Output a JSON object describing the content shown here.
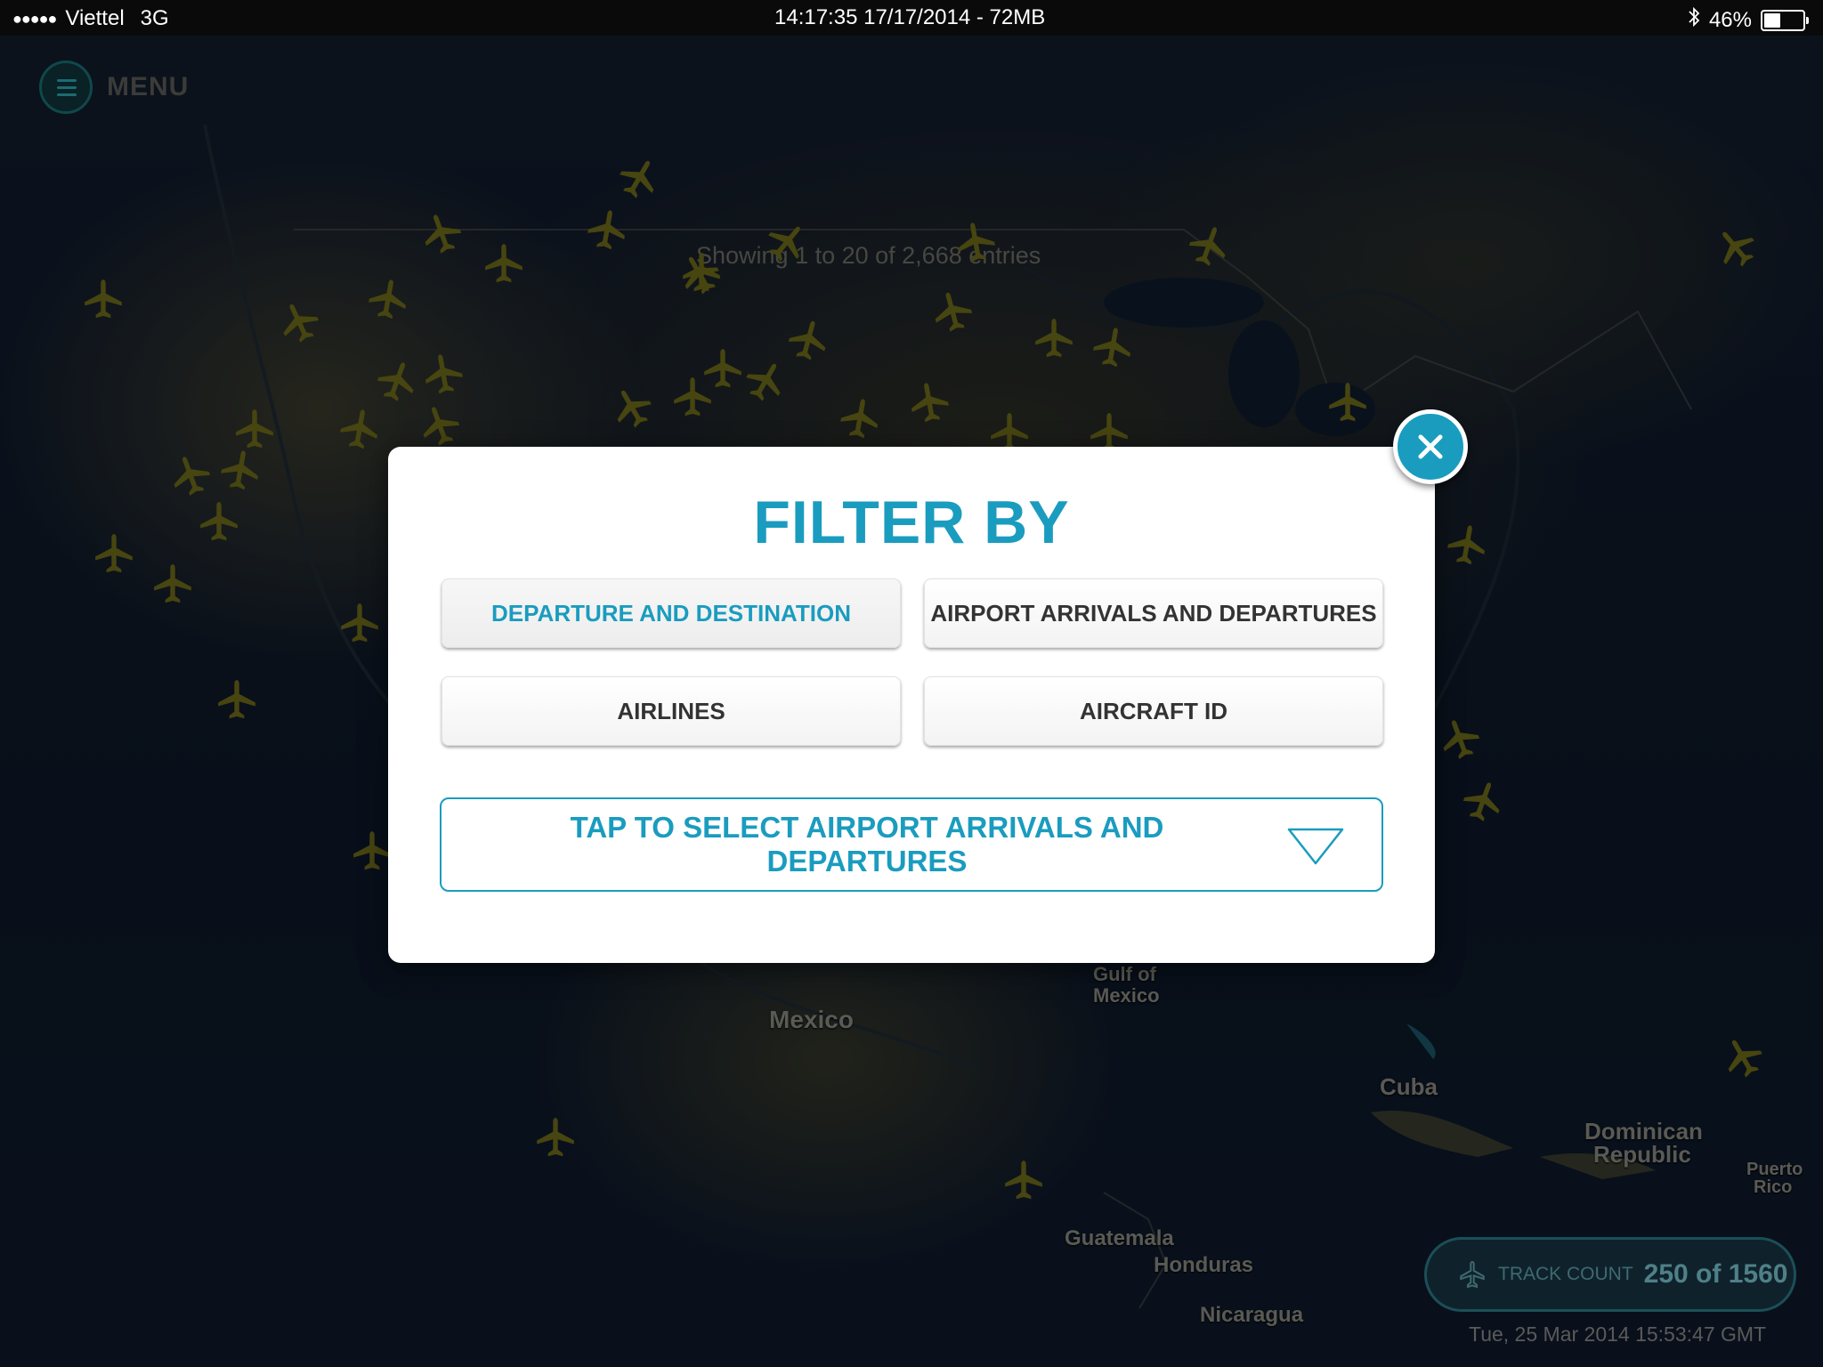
{
  "status_bar": {
    "signal_dots": "●●●●●",
    "carrier": "Viettel",
    "network": "3G",
    "center_info": "14:17:35 17/17/2014 - 72MB",
    "bluetooth_icon": "bluetooth-icon",
    "battery_percent": "46%",
    "battery_level": 0.46
  },
  "menu": {
    "label": "MENU",
    "icon": "hamburger-icon"
  },
  "map": {
    "showing_text": "Showing 1 to 20 of 2,668 entries",
    "labels": {
      "mexico": "Mexico",
      "gulf_line1": "Gulf of",
      "gulf_line2": "Mexico",
      "cuba": "Cuba",
      "dominican_line1": "Dominican",
      "dominican_line2": "Republic",
      "puerto_line1": "Puerto",
      "puerto_line2": "Rico",
      "guatemala": "Guatemala",
      "honduras": "Honduras",
      "nicaragua": "Nicaragua"
    },
    "plane_color": "#6e6a1a"
  },
  "filter_modal": {
    "title": "FILTER BY",
    "options": {
      "departure_destination": "DEPARTURE AND DESTINATION",
      "airport_arrivals": "AIRPORT ARRIVALS AND DEPARTURES",
      "airlines": "AIRLINES",
      "aircraft_id": "AIRCRAFT ID"
    },
    "select_placeholder": "TAP TO SELECT AIRPORT ARRIVALS AND DEPARTURES",
    "accent_color": "#1a9cbf"
  },
  "track_count": {
    "label": "TRACK COUNT",
    "value": "250 of 1560"
  },
  "timestamp": "Tue, 25 Mar 2014 15:53:47 GMT"
}
